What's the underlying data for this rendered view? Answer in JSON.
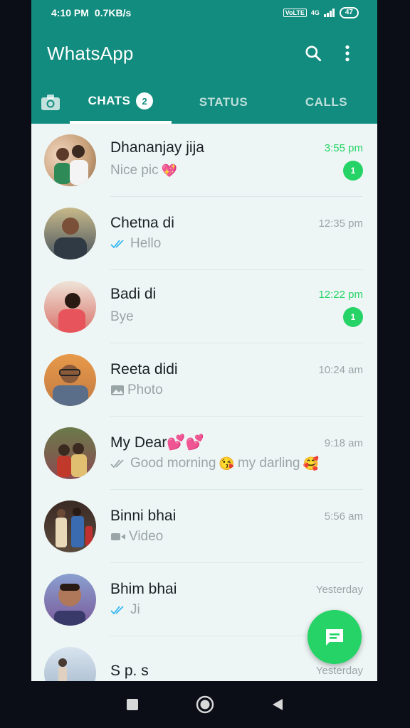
{
  "status_bar": {
    "time": "4:10 PM",
    "speed": "0.7KB/s",
    "net": "4G",
    "battery": "47"
  },
  "app": {
    "title": "WhatsApp"
  },
  "tabs": {
    "chats": "CHATS",
    "chats_count": "2",
    "status": "STATUS",
    "calls": "CALLS"
  },
  "chats": [
    {
      "name": "Dhananjay jija",
      "preview": "Nice pic",
      "time": "3:55 pm",
      "unread": "1",
      "avatar_color": "#c9a17a"
    },
    {
      "name": "Chetna di",
      "preview": "Hello",
      "time": "12:35 pm",
      "avatar_color": "#4a5560"
    },
    {
      "name": "Badi di",
      "preview": "Bye",
      "time": "12:22 pm",
      "unread": "1",
      "avatar_color": "#d9736b"
    },
    {
      "name": "Reeta didi",
      "preview": "Photo",
      "time": "10:24 am",
      "avatar_color": "#c27a42"
    },
    {
      "name": "My Dear💕💕",
      "preview_a": "Good morning",
      "preview_b": "my darling",
      "time": "9:18 am",
      "avatar_color": "#8a4b52"
    },
    {
      "name": "Binni bhai",
      "preview": "Video",
      "time": "5:56 am",
      "avatar_color": "#5a4a3c"
    },
    {
      "name": "Bhim bhai",
      "preview": "Ji",
      "time": "Yesterday",
      "avatar_color": "#7a5a9a"
    },
    {
      "name": "S p. s",
      "time": "Yesterday",
      "avatar_color": "#a0b4c8"
    }
  ],
  "colors": {
    "brand": "#128c7e",
    "accent": "#25d366"
  }
}
